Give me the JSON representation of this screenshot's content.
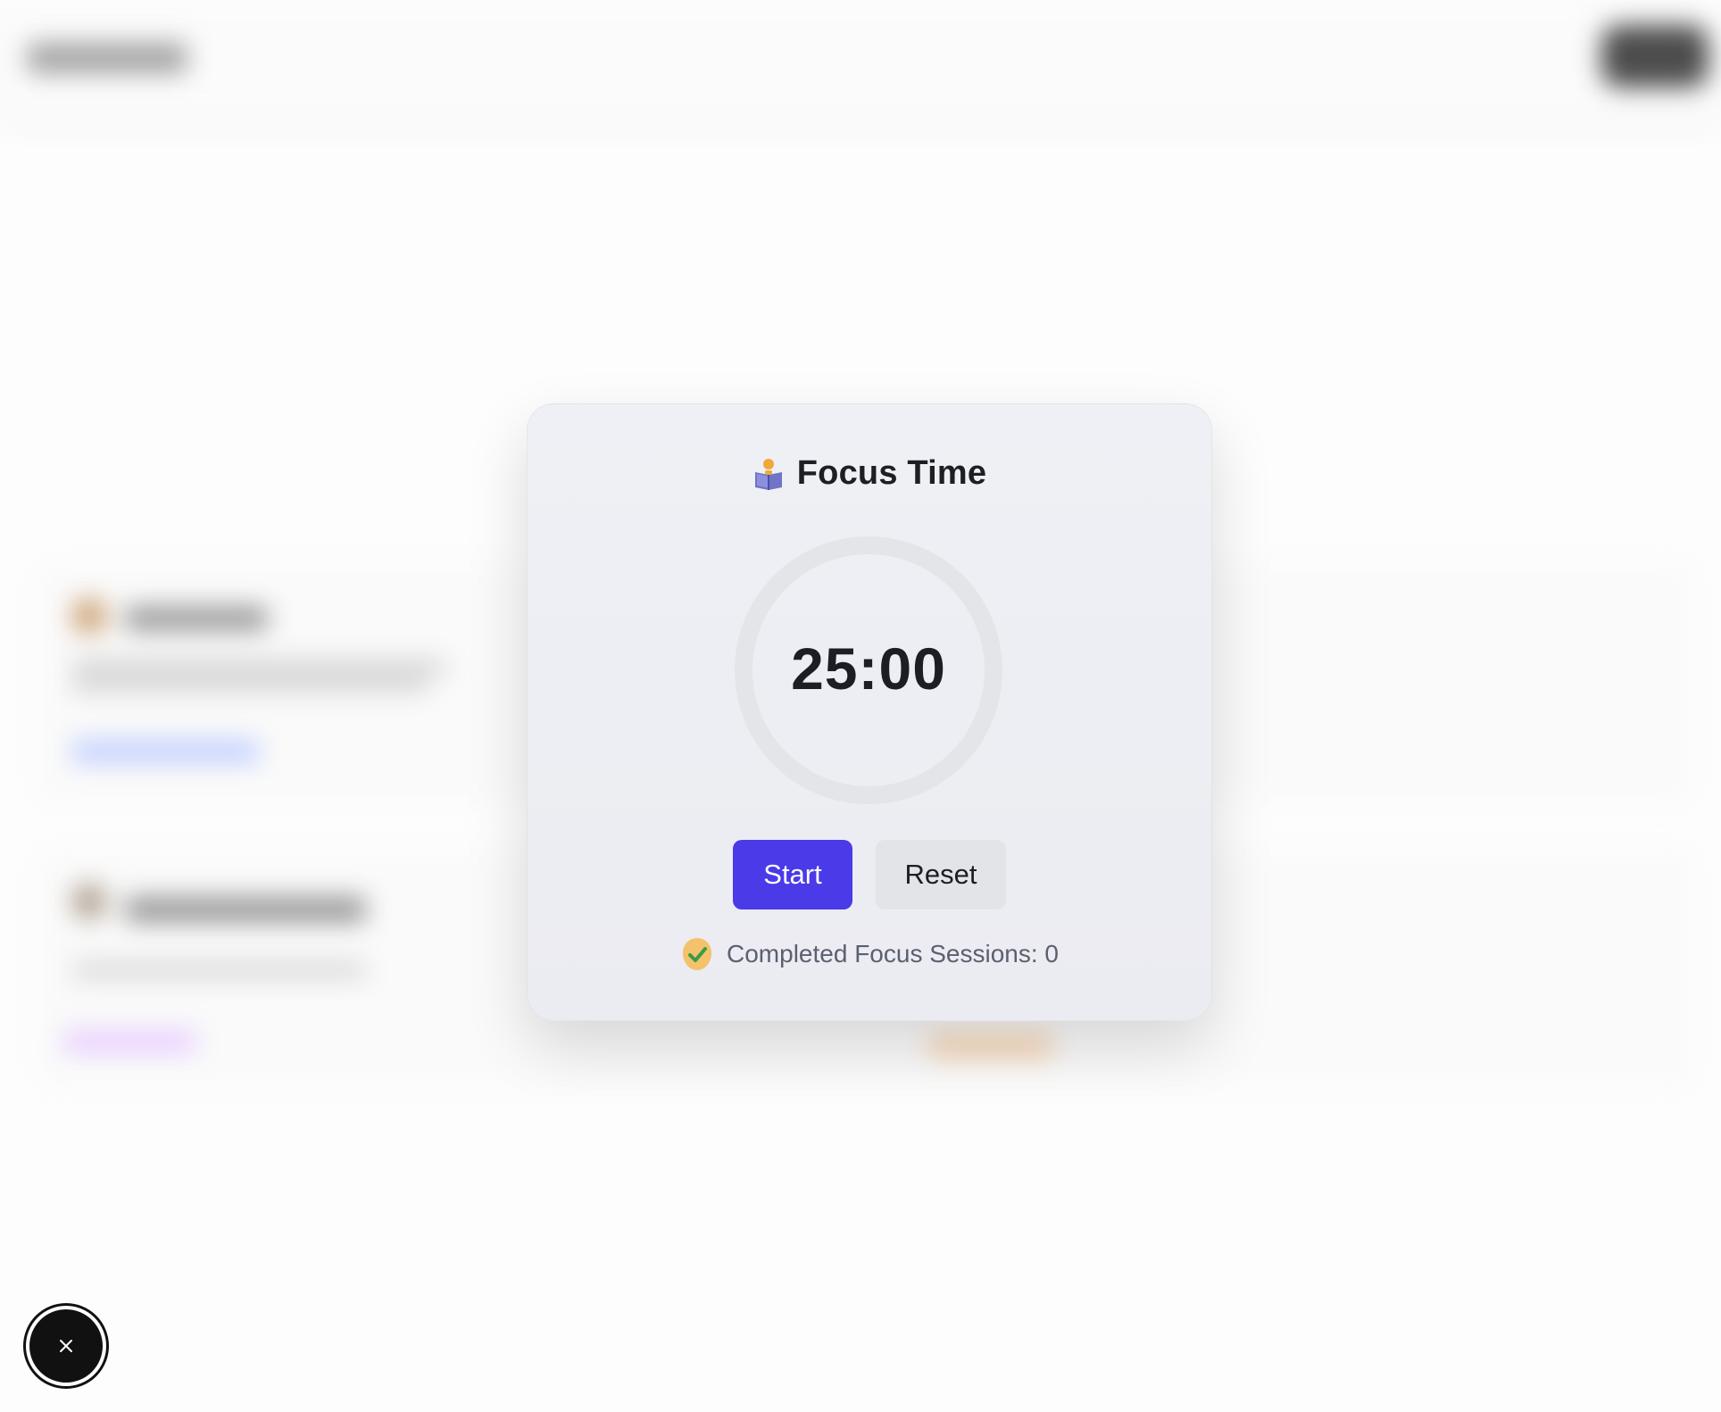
{
  "modal": {
    "title": "Focus Time",
    "title_icon": "person-reading-book-icon",
    "timer": "25:00",
    "progress": 0,
    "start_label": "Start",
    "reset_label": "Reset",
    "sessions_label": "Completed Focus Sessions: 0",
    "sessions_icon": "check-badge-icon"
  },
  "fab": {
    "icon": "close-icon"
  },
  "colors": {
    "accent": "#4a3ae8",
    "reset_bg": "#e3e4e8",
    "ring_track": "#e4e5e9",
    "badge_yellow": "#f3c26a",
    "badge_check": "#3a9a4a"
  }
}
